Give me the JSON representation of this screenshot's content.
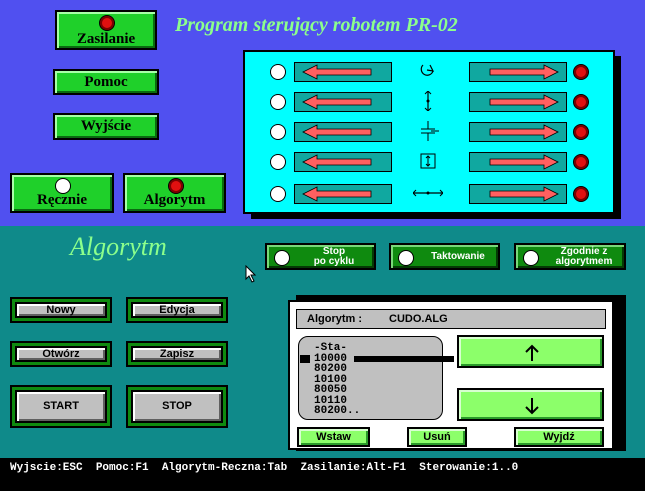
{
  "window": {
    "title": "Program sterujący robotem PR-02"
  },
  "top_buttons": {
    "zasilanie": "Zasilanie",
    "pomoc": "Pomoc",
    "wyjscie": "Wyjście",
    "recznie": "Ręcznie",
    "algorytm": "Algorytm"
  },
  "panel": {
    "rows": [
      {
        "symbol": "rotate-icon"
      },
      {
        "symbol": "vertical-axis-icon"
      },
      {
        "symbol": "gripper-vertical-icon"
      },
      {
        "symbol": "gripper-open-icon"
      },
      {
        "symbol": "horizontal-axis-icon"
      }
    ],
    "left_light_color": "#ffffff",
    "right_light_color": "#e01010"
  },
  "algorithm_section": {
    "title": "Algorytm",
    "options": {
      "stop_line1": "Stop",
      "stop_line2": "po cyklu",
      "taktowanie": "Taktowanie",
      "zgodnie_line1": "Zgodnie z",
      "zgodnie_line2": "algorytmem"
    },
    "buttons": {
      "nowy": "Nowy",
      "edycja": "Edycja",
      "otworz": "Otwórz",
      "zapisz": "Zapisz",
      "start": "START",
      "stop": "STOP"
    },
    "window": {
      "label": "Algorytm :",
      "filename": "CUDO.ALG",
      "list": [
        "-Sta-",
        "10000",
        "80200",
        "10100",
        "80050",
        "10110",
        "80200.."
      ],
      "selected_index": 1,
      "up_icon": "arrow-up-icon",
      "down_icon": "arrow-down-icon",
      "wstaw": "Wstaw",
      "usun": "Usuń",
      "wyjdz": "Wyjdź"
    }
  },
  "statusbar": {
    "text": "Wyjscie:ESC  Pomoc:F1  Algorytm-Reczna:Tab  Zasilanie:Alt-F1  Sterowanie:1..0"
  },
  "colors": {
    "top_bg": "#5050f0",
    "bottom_bg": "#0f8a8a",
    "panel_bg": "#00ffff",
    "arrow": "#ff6060",
    "button_green": "#1fd02a"
  }
}
